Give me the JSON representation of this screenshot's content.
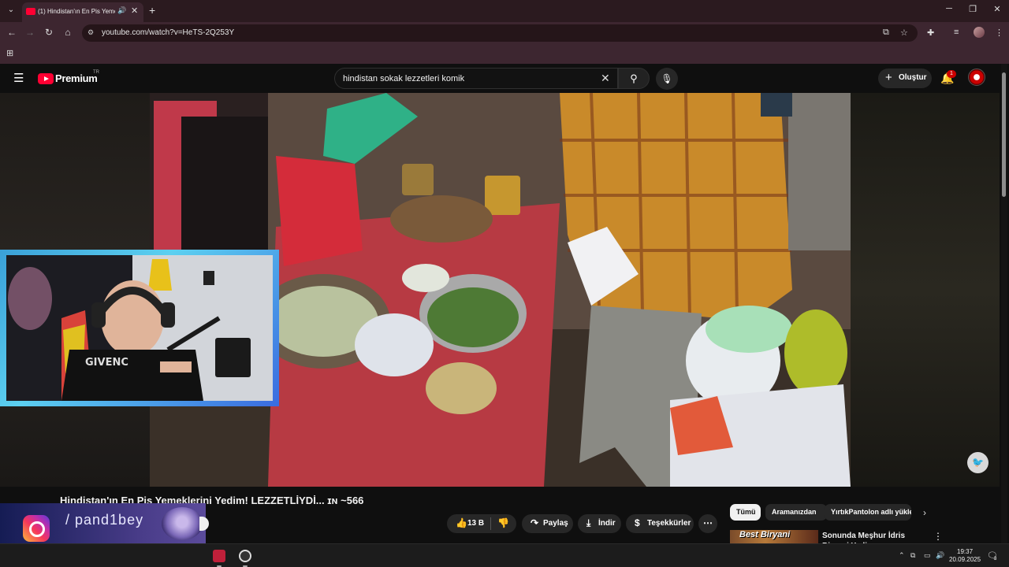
{
  "browser": {
    "tab": {
      "title": "(1) Hindistan'ın En Pis Yeme",
      "audio_icon": "speaker-icon",
      "close_icon": "close-icon"
    },
    "new_tab_icon": "plus-icon",
    "address": {
      "url": "youtube.com/watch?v=HeTS-2Q253Y"
    },
    "window_controls": [
      "minimize-icon",
      "restore-icon",
      "close-icon"
    ]
  },
  "youtube": {
    "brand": "Premium",
    "region": "TR",
    "search": {
      "query": "hindistan sokak lezzetleri komik"
    },
    "create_label": "Oluştur",
    "notifications_count": "1"
  },
  "video": {
    "title": "Hindistan'ın En Pis Yemeklerini Yedim! LEZZETLİYDİ... ɪɴ ~566",
    "likes": "13 B",
    "share_label": "Paylaş",
    "download_label": "İndir",
    "thanks_label": "Teşekkürler"
  },
  "overlay": {
    "handle": "/ pand1bey"
  },
  "chips": [
    "Tümü",
    "Aramanızdan",
    "YırtıkPantolon adlı yükle"
  ],
  "recommendation": {
    "thumb_text": "Best Biryani",
    "title": "Sonunda Meşhur İdris Biryani Yedim (Hindistan'ın En İyisi) w"
  },
  "taskbar": {
    "time": "19:37",
    "date": "20.09.2025",
    "notification_count": "3"
  },
  "colors": {
    "youtube_red": "#ff0033",
    "chrome_bg": "#3d2630",
    "yt_bg": "#0f0f0f"
  }
}
